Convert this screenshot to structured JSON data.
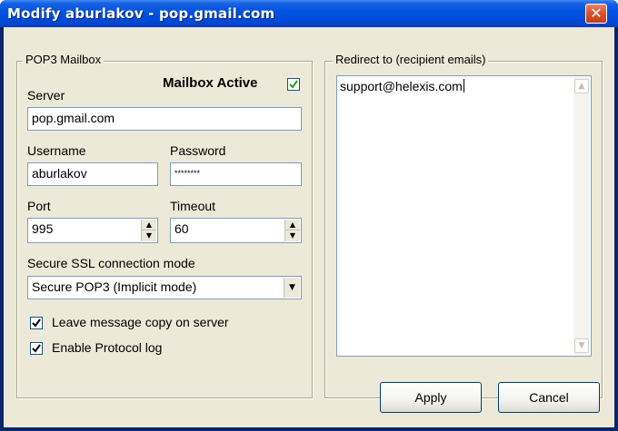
{
  "window": {
    "title": "Modify aburlakov - pop.gmail.com",
    "close_glyph": "✕"
  },
  "pop3": {
    "legend": "POP3 Mailbox",
    "mailbox_active_label": "Mailbox Active",
    "mailbox_active_checked": true,
    "server_label": "Server",
    "server_value": "pop.gmail.com",
    "username_label": "Username",
    "username_value": "aburlakov",
    "password_label": "Password",
    "password_value": "********",
    "port_label": "Port",
    "port_value": "995",
    "timeout_label": "Timeout",
    "timeout_value": "60",
    "ssl_label": "Secure SSL connection mode",
    "ssl_value": "Secure POP3 (Implicit mode)",
    "leave_copy_label": "Leave message copy on server",
    "leave_copy_checked": true,
    "protocol_log_label": "Enable Protocol log",
    "protocol_log_checked": true
  },
  "redirect": {
    "legend": "Redirect to (recipient emails)",
    "value": "support@helexis.com"
  },
  "buttons": {
    "apply_label": "Apply",
    "cancel_label": "Cancel"
  },
  "colors": {
    "title_bar": "#0054e3",
    "dialog_bg": "#ece9d8",
    "close_button": "#d8502c"
  }
}
